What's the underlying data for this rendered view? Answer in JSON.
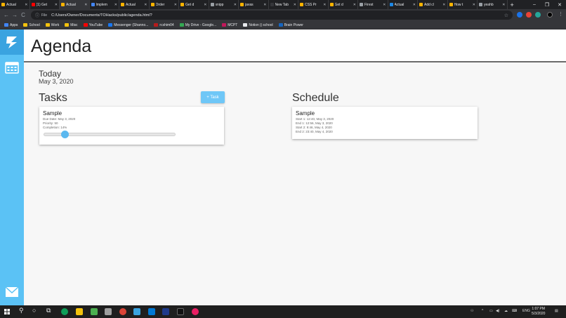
{
  "browser": {
    "tabs": [
      {
        "title": "Actual",
        "color": "#ffb300"
      },
      {
        "title": "(1) Get",
        "color": "#ff0000"
      },
      {
        "title": "Actual",
        "color": "#ffb300",
        "active": true
      },
      {
        "title": "Implem",
        "color": "#4285f4"
      },
      {
        "title": "Actual",
        "color": "#ffb300"
      },
      {
        "title": "Order",
        "color": "#ffb300"
      },
      {
        "title": "Get d",
        "color": "#ffb300"
      },
      {
        "title": "snipp",
        "color": "#9aa0a6"
      },
      {
        "title": "javas",
        "color": "#ffb300"
      },
      {
        "title": "New Tab",
        "color": "#35363a"
      },
      {
        "title": "CSS Pr",
        "color": "#ffb300"
      },
      {
        "title": "Get d",
        "color": "#ffb300"
      },
      {
        "title": "Firest",
        "color": "#9aa0a6"
      },
      {
        "title": "Actual",
        "color": "#1e88e5"
      },
      {
        "title": "Add cl",
        "color": "#ffb300"
      },
      {
        "title": "How t",
        "color": "#ffb300"
      },
      {
        "title": "yeahb",
        "color": "#9aa0a6"
      }
    ],
    "tab_close": "✕",
    "new_tab": "+",
    "window_controls": {
      "minimize": "–",
      "maximize": "❐",
      "close": "✕"
    },
    "nav": {
      "back": "←",
      "forward": "→",
      "reload": "C"
    },
    "address": {
      "scheme": "File",
      "url": "C:/Users/Owner/Documents/TOHacks/public/agenda.html?"
    },
    "bookmarks": [
      {
        "label": "Apps",
        "color": "#4285f4"
      },
      {
        "label": "School",
        "color": "#f4c20d"
      },
      {
        "label": "Work",
        "color": "#f4c20d"
      },
      {
        "label": "Misc",
        "color": "#f4c20d"
      },
      {
        "label": "YouTube",
        "color": "#ff0000"
      },
      {
        "label": "Messenger (Shanno...",
        "color": "#1877f2"
      },
      {
        "label": "rcshim04",
        "color": "#b71c1c"
      },
      {
        "label": "My Drive - Google...",
        "color": "#34a853"
      },
      {
        "label": "MCPT",
        "color": "#c2185b"
      },
      {
        "label": "Notion || school",
        "color": "#e8eaed"
      },
      {
        "label": "Brain Power",
        "color": "#1565c0"
      }
    ]
  },
  "app": {
    "title": "Agenda",
    "today_label": "Today",
    "today_date": "May 3, 2020",
    "tasks_heading": "Tasks",
    "add_task_label": "+ Task",
    "schedule_heading": "Schedule",
    "task": {
      "title": "Sample",
      "due": "Due Date: May 3, 2020",
      "priority": "Priority: 50",
      "completion": "Completion: 14%",
      "completion_fraction": 0.14
    },
    "schedule_item": {
      "title": "Sample",
      "lines": [
        "Start 1: 12:40, May 3, 2020",
        "End 1: 12:56, May 3, 2020",
        "Start 2: 9:46, May 4, 2020",
        "End 2: 23:40, May 4, 2020"
      ]
    },
    "accent_color": "#5bc2f5"
  },
  "taskbar": {
    "lang": "ENG",
    "time": "1:07 PM",
    "date": "5/3/2020"
  }
}
